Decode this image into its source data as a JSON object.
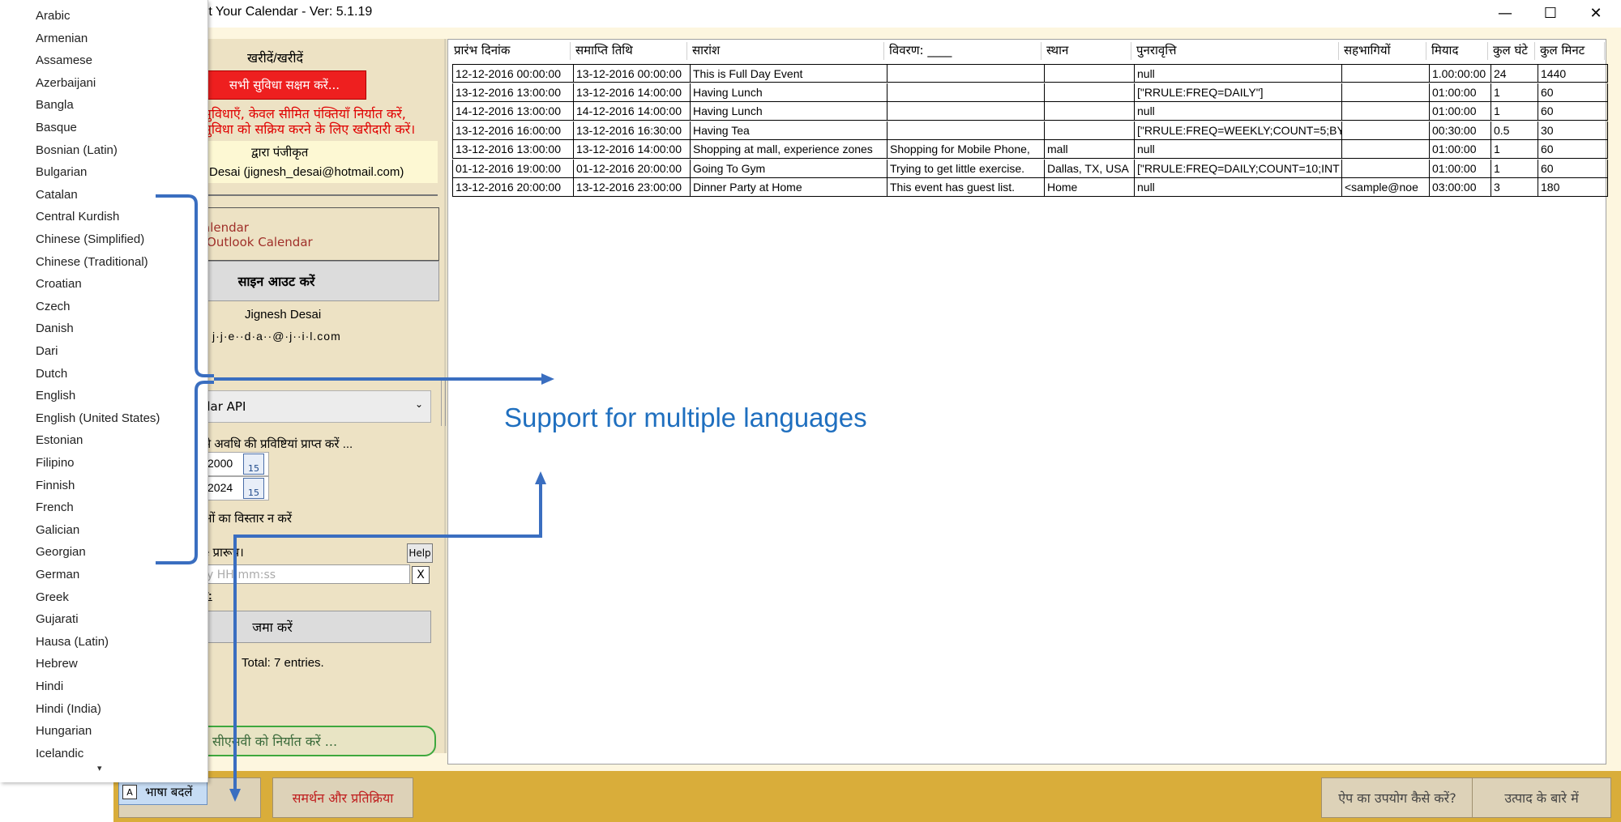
{
  "window": {
    "title": "rt Your Calendar - Ver: 5.1.19",
    "minimize": "—",
    "maximize": "☐",
    "close": "✕"
  },
  "left_panel": {
    "purchase_heading": "खरीदें/खरीदें",
    "enable_all_button": "सभी सुविधा सक्षम करें...",
    "warning_line1": "सुविधाएँ, केवल सीमित पंक्तियाँ निर्यात करें,",
    "warning_line2": "सुविधा को सक्रिय करने के लिए खरीदारी करें।",
    "registered_by_label": "द्वारा पंजीकृत",
    "registered_by_value": "Desai (jignesh_desai@hotmail.com)",
    "calendar_line1": "alendar",
    "calendar_line2": "/Outlook Calendar",
    "signout_button": "साइन आउट करें",
    "user_name": "Jignesh Desai",
    "user_email": "j·j·e··d·a··@·j··i·l.com",
    "api_select": "dar API",
    "date_range_label": "से अवधि की प्रविष्टियां प्राप्त करें ...",
    "date_from": "2000",
    "date_to": "2024",
    "calendar_icon_glyph": "15",
    "no_expand_label": "ओं का विस्तार न करें",
    "time_label": "e प्रारूप।",
    "help_button": "Help",
    "time_placeholder": "y HH:mm:ss",
    "time_clear": "X",
    "time_hint": "ट:",
    "submit_button": "जमा करें",
    "total_entries": "Total: 7 entries.",
    "csv_button": "सीएसवी को निर्यात करें ..."
  },
  "grid": {
    "columns": [
      "प्रारंभ दिनांक",
      "समाप्ति तिथि",
      "सारांश",
      "विवरण: ____",
      "स्थान",
      "पुनरावृत्ति",
      "सहभागियों",
      "मियाद",
      "कुल घंटे",
      "कुल मिनट"
    ],
    "rows": [
      [
        "12-12-2016 00:00:00",
        "13-12-2016 00:00:00",
        "This is Full Day Event",
        "",
        "",
        "null",
        "",
        "1.00:00:00",
        "24",
        "1440"
      ],
      [
        "13-12-2016 13:00:00",
        "13-12-2016 14:00:00",
        "Having Lunch",
        "",
        "",
        "[\"RRULE:FREQ=DAILY\"]",
        "",
        "01:00:00",
        "1",
        "60"
      ],
      [
        "14-12-2016 13:00:00",
        "14-12-2016 14:00:00",
        "Having Lunch",
        "",
        "",
        "null",
        "",
        "01:00:00",
        "1",
        "60"
      ],
      [
        "13-12-2016 16:00:00",
        "13-12-2016 16:30:00",
        "Having Tea",
        "",
        "",
        "[\"RRULE:FREQ=WEEKLY;COUNT=5;BY",
        "",
        "00:30:00",
        "0.5",
        "30"
      ],
      [
        "13-12-2016 13:00:00",
        "13-12-2016 14:00:00",
        "Shopping at mall, experience zones",
        "Shopping for Mobile Phone,",
        "mall",
        "null",
        "",
        "01:00:00",
        "1",
        "60"
      ],
      [
        "01-12-2016 19:00:00",
        "01-12-2016 20:00:00",
        "Going To Gym",
        "Trying to get little exercise.",
        "Dallas, TX, USA",
        "[\"RRULE:FREQ=DAILY;COUNT=10;INT",
        "",
        "01:00:00",
        "1",
        "60"
      ],
      [
        "13-12-2016 20:00:00",
        "13-12-2016 23:00:00",
        "Dinner Party at Home",
        "This event has guest list.",
        "Home",
        "null",
        "<sample@noe",
        "03:00:00",
        "3",
        "180"
      ]
    ]
  },
  "annotation": {
    "text": "Support for multiple languages",
    "color": "#1f6fbf"
  },
  "bottom_bar": {
    "change_language_button": "भाषा बदलें",
    "language_icon_glyph": "A",
    "support_button": "समर्थन और प्रतिक्रिया",
    "howto_button": "ऐप का उपयोग कैसे करें?",
    "about_button": "उत्पाद के बारे में"
  },
  "language_list": {
    "items": [
      "Arabic",
      "Armenian",
      "Assamese",
      "Azerbaijani",
      "Bangla",
      "Basque",
      "Bosnian (Latin)",
      "Bulgarian",
      "Catalan",
      "Central Kurdish",
      "Chinese (Simplified)",
      "Chinese (Traditional)",
      "Croatian",
      "Czech",
      "Danish",
      "Dari",
      "Dutch",
      "English",
      "English (United States)",
      "Estonian",
      "Filipino",
      "Finnish",
      "French",
      "Galician",
      "Georgian",
      "German",
      "Greek",
      "Gujarati",
      "Hausa (Latin)",
      "Hebrew",
      "Hindi",
      "Hindi (India)",
      "Hungarian",
      "Icelandic"
    ],
    "scroll_glyph": "▾"
  }
}
